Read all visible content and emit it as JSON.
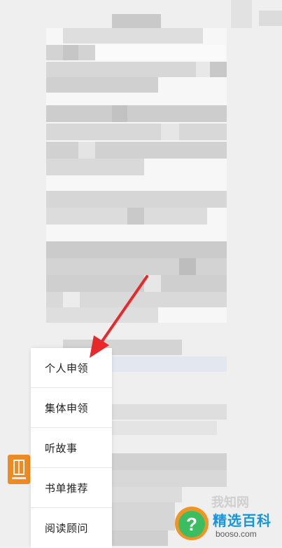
{
  "menu": {
    "items": [
      {
        "label": "个人申领"
      },
      {
        "label": "集体申领"
      },
      {
        "label": "听故事"
      },
      {
        "label": "书单推荐"
      },
      {
        "label": "阅读顾问"
      }
    ]
  },
  "watermark": {
    "brand": "精选百科",
    "url": "booso.com",
    "faint_text": "我知网"
  },
  "colors": {
    "arrow": "#e8282a",
    "accent_orange": "#ee8a22",
    "watermark_blue": "#1596d8"
  }
}
